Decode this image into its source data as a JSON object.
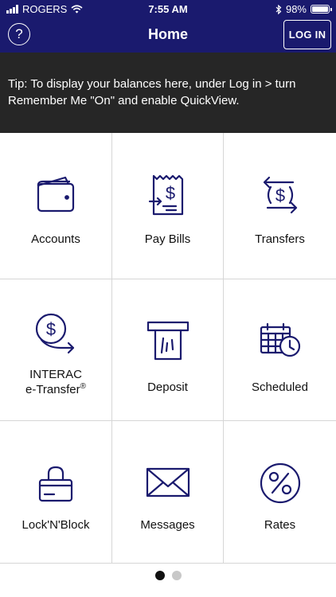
{
  "status_bar": {
    "carrier": "ROGERS",
    "time": "7:55 AM",
    "battery": "98%",
    "battery_level": 0.98
  },
  "nav": {
    "help_label": "?",
    "title": "Home",
    "login_label": "LOG IN"
  },
  "tip": {
    "text": "Tip: To display your balances here, under Log in > turn Remember Me \"On\" and enable QuickView."
  },
  "tiles": [
    {
      "label": "Accounts",
      "icon": "wallet-icon"
    },
    {
      "label": "Pay Bills",
      "icon": "bill-icon"
    },
    {
      "label": "Transfers",
      "icon": "transfer-icon"
    },
    {
      "label_line1": "INTERAC",
      "label_line2": "e-Transfer",
      "label_sup": "®",
      "icon": "etransfer-icon"
    },
    {
      "label": "Deposit",
      "icon": "deposit-icon"
    },
    {
      "label": "Scheduled",
      "icon": "calendar-clock-icon"
    },
    {
      "label": "Lock'N'Block",
      "icon": "card-lock-icon"
    },
    {
      "label": "Messages",
      "icon": "envelope-icon"
    },
    {
      "label": "Rates",
      "icon": "percent-icon"
    }
  ],
  "pager": {
    "pages": 2,
    "active": 0
  },
  "colors": {
    "nav_bg": "#1a1a6e",
    "tip_bg": "#262626",
    "icon": "#1a1a6e"
  }
}
